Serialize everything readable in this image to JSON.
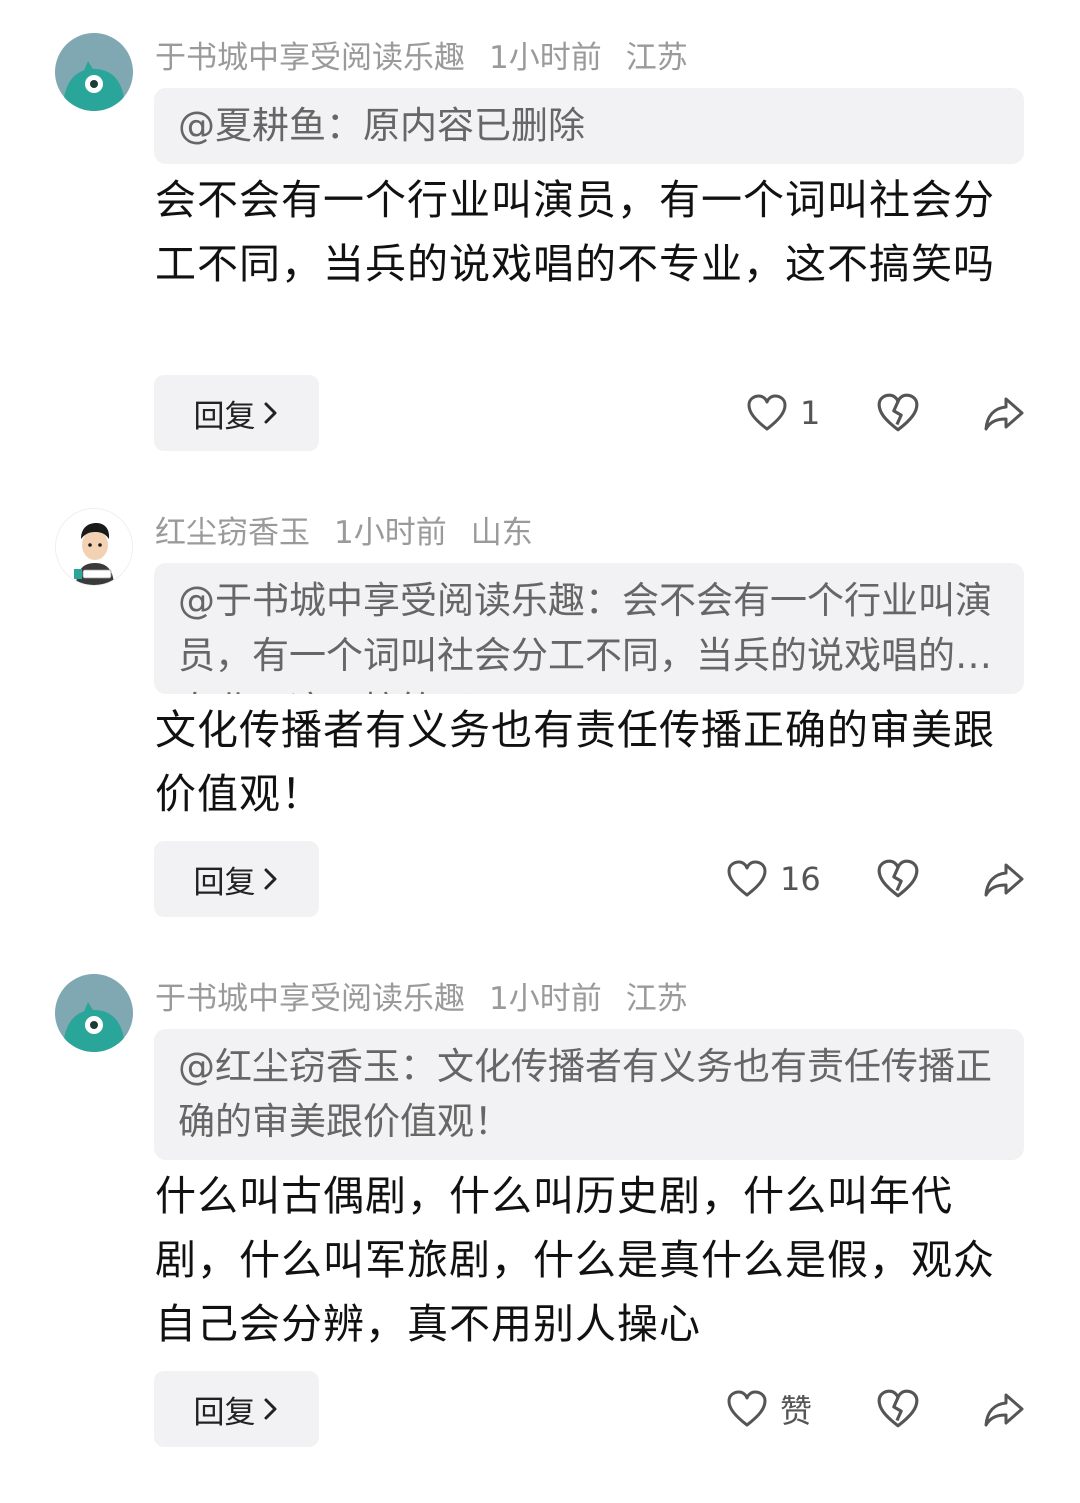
{
  "comments": [
    {
      "username": "于书城中享受阅读乐趣",
      "time": "1小时前",
      "location": "江苏",
      "quote": "@夏耕鱼：原内容已删除",
      "text": "会不会有一个行业叫演员，有一个词叫社会分工不同，当兵的说戏唱的不专业，这不搞笑吗",
      "reply_label": "回复",
      "like_count": "1",
      "avatar_icon": "teal-monster-avatar-icon"
    },
    {
      "username": "红尘窃香玉",
      "time": "1小时前",
      "location": "山东",
      "quote": "@于书城中享受阅读乐趣：会不会有一个行业叫演员，有一个词叫社会分工不同，当兵的说戏唱的不专业，这不搞笑吗",
      "text": "文化传播者有义务也有责任传播正确的审美跟价值观！",
      "reply_label": "回复",
      "like_count": "16",
      "avatar_icon": "cartoon-man-avatar-icon"
    },
    {
      "username": "于书城中享受阅读乐趣",
      "time": "1小时前",
      "location": "江苏",
      "quote": "@红尘窃香玉：文化传播者有义务也有责任传播正确的审美跟价值观！",
      "text": "什么叫古偶剧，什么叫历史剧，什么叫年代剧，什么叫军旅剧，什么是真什么是假，观众自己会分辨，真不用别人操心",
      "reply_label": "回复",
      "like_count": "赞",
      "avatar_icon": "teal-monster-avatar-icon"
    }
  ],
  "colors": {
    "teal": "#2aa59a",
    "avatar_bg": "#7fa8b3",
    "meta_gray": "#9a9a9a",
    "bubble_bg": "#f2f2f4"
  }
}
